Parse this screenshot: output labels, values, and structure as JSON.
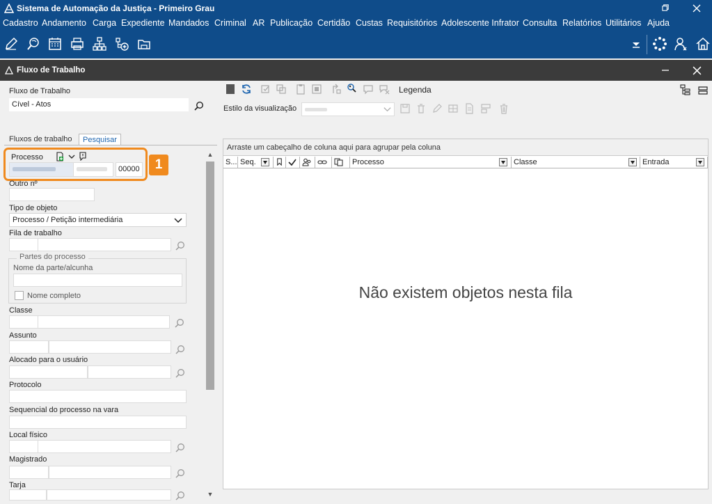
{
  "app": {
    "title": "Sistema de Automação da Justiça - Primeiro Grau",
    "window_buttons": [
      "restore",
      "close"
    ]
  },
  "menu": [
    "Cadastro",
    "Andamento",
    "Carga",
    "Expediente",
    "Mandados",
    "Criminal",
    "AR",
    "Publicação",
    "Certidão",
    "Custas",
    "Requisitórios",
    "Adolescente Infrator",
    "Consulta",
    "Relatórios",
    "Utilitários",
    "Ajuda"
  ],
  "toolbar_icons": [
    "edit-icon",
    "search-document-icon",
    "calendar-icon",
    "printer-icon",
    "hierarchy-icon",
    "add-network-icon",
    "folder-icon"
  ],
  "toolbar_right_icons": [
    "dropdown-arrow-icon",
    "loading-icon",
    "users-icon",
    "home-icon"
  ],
  "window": {
    "title": "Fluxo de Trabalho"
  },
  "left": {
    "fluxo_label": "Fluxo de Trabalho",
    "fluxo_value": "Cível - Atos",
    "tabs": [
      "Fluxos de trabalho",
      "Pesquisar"
    ],
    "active_tab": "Pesquisar",
    "processo_label": "Processo",
    "processo_number_suffix": "00000",
    "outro_label": "Outro nº",
    "tipo_objeto_label": "Tipo de objeto",
    "tipo_objeto_value": "Processo / Petição intermediária",
    "fila_label": "Fila de trabalho",
    "partes_legend": "Partes do processo",
    "nome_parte_label": "Nome da parte/alcunha",
    "nome_completo_label": "Nome completo",
    "classe_label": "Classe",
    "assunto_label": "Assunto",
    "alocado_label": "Alocado para o usuário",
    "protocolo_label": "Protocolo",
    "sequencial_label": "Sequencial do processo na vara",
    "local_label": "Local físico",
    "magistrado_label": "Magistrado",
    "tarja_label": "Tarja",
    "highlight_badge": "1"
  },
  "right": {
    "legenda_label": "Legenda",
    "estilo_label": "Estilo da visualização",
    "group_bar_text": "Arraste um cabeçalho de coluna aqui para agrupar pela coluna",
    "columns": [
      "S...",
      "Seq.",
      "Processo",
      "Classe",
      "Entrada"
    ],
    "empty_message": "Não existem objetos nesta fila"
  },
  "colors": {
    "title_bar": "#0f4c8a",
    "window_header": "#3b3b3b",
    "highlight": "#f08a1e",
    "active_tab_text": "#1f66b0"
  }
}
